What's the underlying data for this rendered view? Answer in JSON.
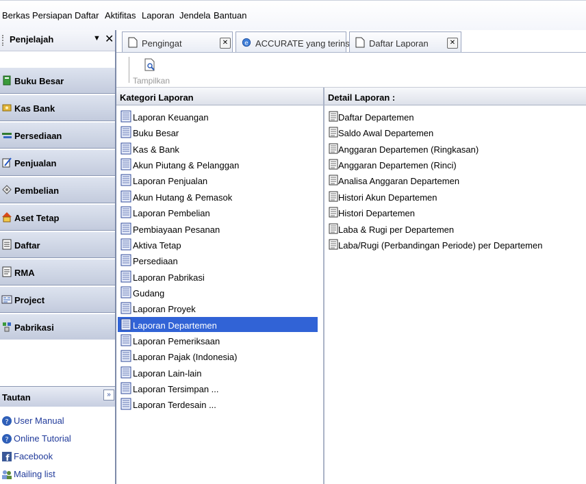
{
  "menu": [
    "Berkas",
    "Persiapan",
    "Daftar",
    "Aktifitas",
    "Laporan",
    "Jendela",
    "Bantuan"
  ],
  "explorer": {
    "title": "Penjelajah",
    "dropdown_glyph": "▼",
    "close_glyph": "✕",
    "nav": [
      {
        "label": "Buku Besar",
        "icon": "ledger-icon"
      },
      {
        "label": "Kas Bank",
        "icon": "cash-bank-icon"
      },
      {
        "label": "Persediaan",
        "icon": "inventory-icon"
      },
      {
        "label": "Penjualan",
        "icon": "sales-icon"
      },
      {
        "label": "Pembelian",
        "icon": "purchase-icon"
      },
      {
        "label": "Aset Tetap",
        "icon": "house-icon"
      },
      {
        "label": "Daftar",
        "icon": "list-icon"
      },
      {
        "label": "RMA",
        "icon": "rma-icon"
      },
      {
        "label": "Project",
        "icon": "project-icon"
      },
      {
        "label": "Pabrikasi",
        "icon": "factory-icon"
      }
    ],
    "tautan": {
      "title": "Tautan",
      "collapse_glyph": "»",
      "links": [
        {
          "label": "User Manual",
          "icon": "help-icon"
        },
        {
          "label": "Online Tutorial",
          "icon": "help-icon"
        },
        {
          "label": "Facebook",
          "icon": "facebook-icon"
        },
        {
          "label": "Mailing list",
          "icon": "users-icon"
        }
      ]
    }
  },
  "tabs": [
    {
      "label": "Pengingat",
      "icon": "document-icon"
    },
    {
      "label": "ACCURATE yang terinsta...",
      "icon": "browser-icon"
    },
    {
      "label": "Daftar Laporan",
      "icon": "document-icon"
    }
  ],
  "toolbar": {
    "show_label": "Tampilkan"
  },
  "kategori": {
    "title": "Kategori Laporan",
    "items": [
      "Laporan Keuangan",
      "Buku Besar",
      "Kas & Bank",
      "Akun Piutang & Pelanggan",
      "Laporan Penjualan",
      "Akun Hutang & Pemasok",
      "Laporan Pembelian",
      "Pembiayaan Pesanan",
      "Aktiva Tetap",
      "Persediaan",
      "Laporan Pabrikasi",
      "Gudang",
      "Laporan Proyek",
      "Laporan Departemen",
      "Laporan Pemeriksaan",
      "Laporan Pajak (Indonesia)",
      "Laporan Lain-lain",
      "Laporan Tersimpan ...",
      "Laporan Terdesain ..."
    ],
    "selected_index": 13
  },
  "detail": {
    "title": "Detail Laporan :",
    "items": [
      "Daftar Departemen",
      "Saldo Awal Departemen",
      "Anggaran Departemen (Ringkasan)",
      "Anggaran Departemen (Rinci)",
      "Analisa Anggaran Departemen",
      "Histori Akun Departemen",
      "Histori Departemen",
      "Laba & Rugi per Departemen",
      "Laba/Rugi (Perbandingan Periode) per Departemen"
    ]
  },
  "colors": {
    "selection": "#3163d6",
    "nav_bg": "#c3cbdd",
    "link": "#203a9a"
  }
}
